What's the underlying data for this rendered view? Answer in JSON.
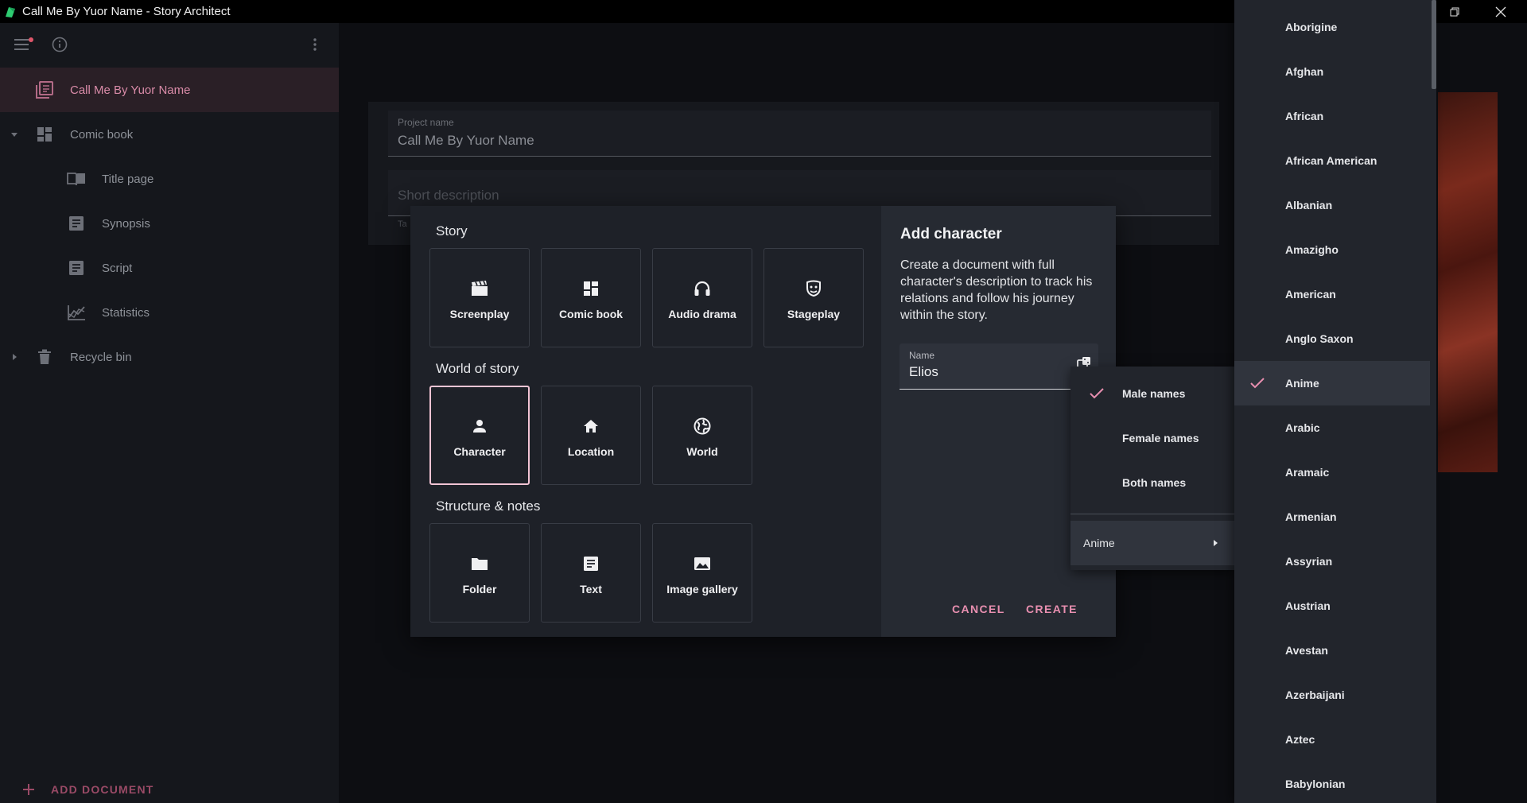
{
  "window": {
    "title": "Call Me By Yuor Name - Story Architect"
  },
  "sidebar": {
    "items": [
      {
        "label": "Call Me By Yuor Name",
        "icon": "project-icon"
      },
      {
        "label": "Comic book",
        "icon": "dashboard-icon"
      },
      {
        "label": "Title page",
        "icon": "book-open-icon"
      },
      {
        "label": "Synopsis",
        "icon": "text-doc-icon"
      },
      {
        "label": "Script",
        "icon": "text-doc-icon"
      },
      {
        "label": "Statistics",
        "icon": "chart-icon"
      },
      {
        "label": "Recycle bin",
        "icon": "trash-icon"
      }
    ],
    "add_document": "ADD DOCUMENT"
  },
  "project": {
    "name_label": "Project name",
    "name_value": "Call Me By Yuor Name",
    "description_placeholder": "Short description",
    "tag_stub": "Ta"
  },
  "dialog": {
    "sections": {
      "story": "Story",
      "world": "World of story",
      "structure": "Structure & notes"
    },
    "story_types": [
      {
        "label": "Screenplay",
        "icon": "clapperboard-icon"
      },
      {
        "label": "Comic book",
        "icon": "dashboard-icon"
      },
      {
        "label": "Audio drama",
        "icon": "headphones-icon"
      },
      {
        "label": "Stageplay",
        "icon": "theater-mask-icon"
      }
    ],
    "world_types": [
      {
        "label": "Character",
        "icon": "person-icon"
      },
      {
        "label": "Location",
        "icon": "home-icon"
      },
      {
        "label": "World",
        "icon": "globe-icon"
      }
    ],
    "structure_types": [
      {
        "label": "Folder",
        "icon": "folder-icon"
      },
      {
        "label": "Text",
        "icon": "text-doc-icon"
      },
      {
        "label": "Image gallery",
        "icon": "image-icon"
      }
    ],
    "heading": "Add character",
    "description": "Create a document with full character's description to track his relations and follow his journey within the story.",
    "name_label": "Name",
    "name_value": "Elios",
    "cancel": "CANCEL",
    "create": "CREATE"
  },
  "name_popup": {
    "options": [
      "Male names",
      "Female names",
      "Both names"
    ],
    "selected": "Male names",
    "submenu": "Anime"
  },
  "origin_list": {
    "items": [
      "Aborigine",
      "Afghan",
      "African",
      "African American",
      "Albanian",
      "Amazigho",
      "American",
      "Anglo Saxon",
      "Anime",
      "Arabic",
      "Aramaic",
      "Armenian",
      "Assyrian",
      "Austrian",
      "Avestan",
      "Azerbaijani",
      "Aztec",
      "Babylonian"
    ],
    "selected": "Anime"
  },
  "colors": {
    "accent": "#e88fb0",
    "selected_border": "#f2c4d4",
    "panel": "#1e2128",
    "menu": "#22252c"
  }
}
